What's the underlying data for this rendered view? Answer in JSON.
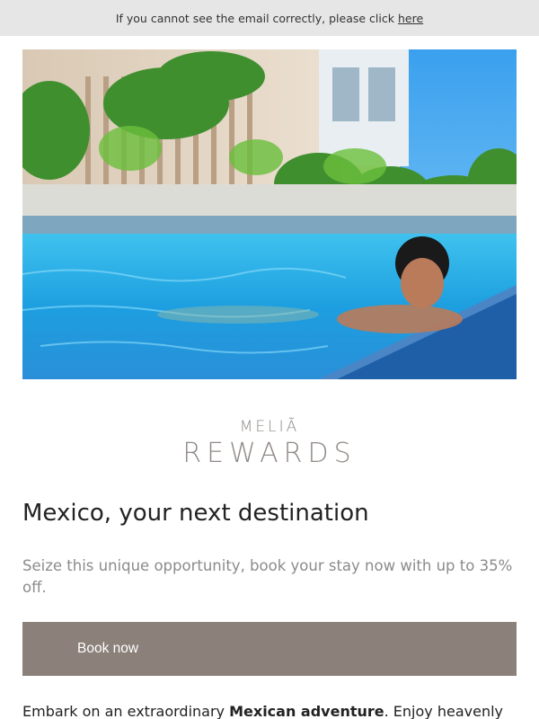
{
  "top_bar": {
    "notice": "If you cannot see the email correctly, please click",
    "link_label": "here"
  },
  "hero": {
    "description_icon": "pool-scene-photo"
  },
  "logo": {
    "line1": "MELIÃ",
    "line2": "REWARDS",
    "color": "#8f8a86"
  },
  "headline": "Mexico, your next destination",
  "subtext": "Seize this unique opportunity, book your stay now with up to 35% off.",
  "cta": {
    "label": "Book now",
    "color": "#8b817a"
  },
  "body": {
    "part1": "Embark on an extraordinary ",
    "bold": "Mexican adventure",
    "part2": ". Enjoy heavenly"
  }
}
